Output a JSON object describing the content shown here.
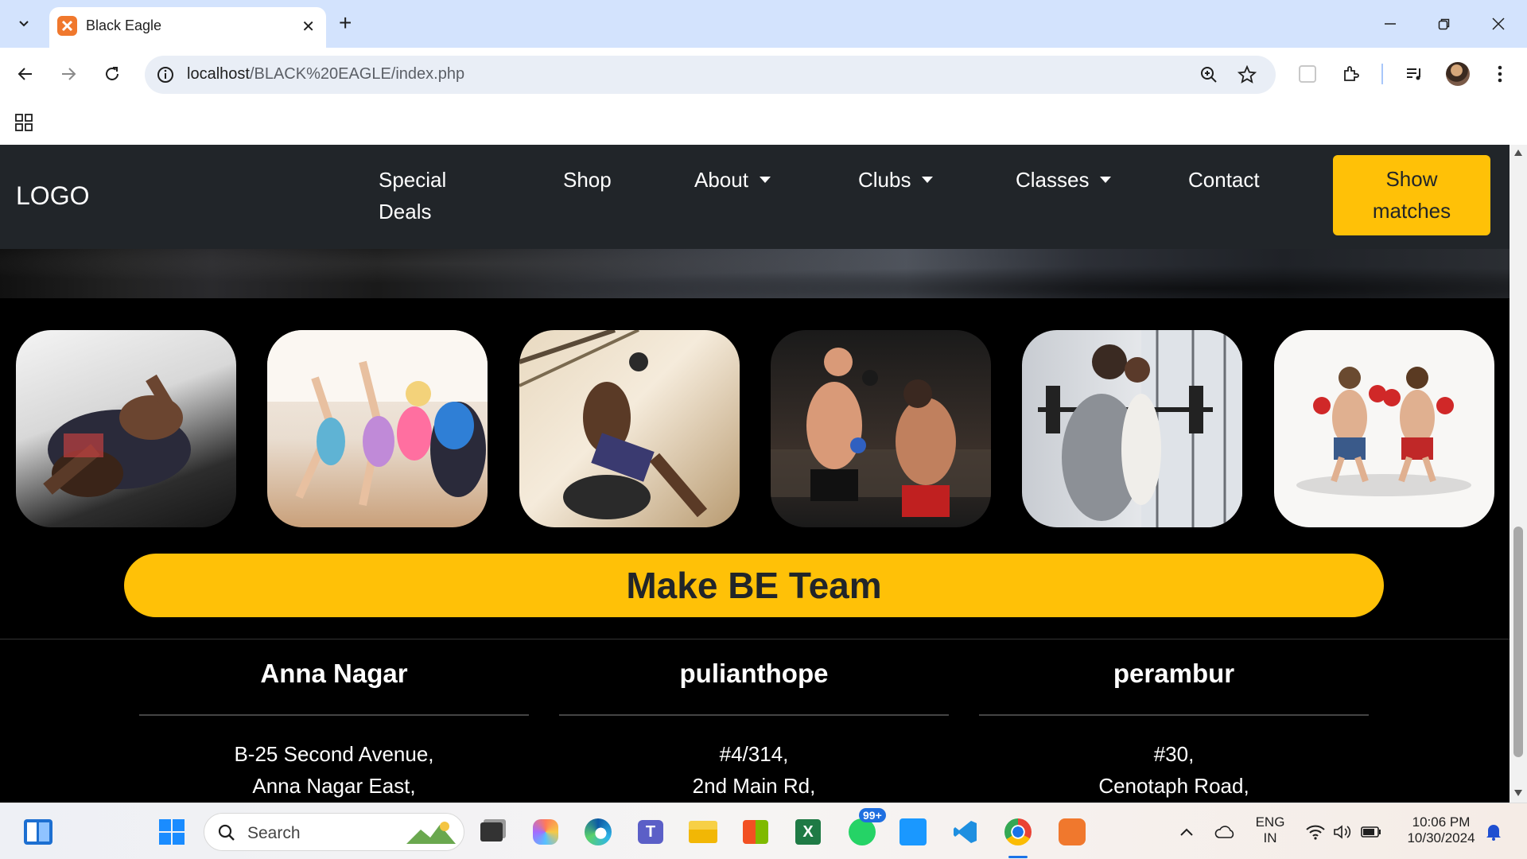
{
  "browser": {
    "tab_title": "Black Eagle",
    "url_host": "localhost",
    "url_path": "/BLACK%20EAGLE/index.php"
  },
  "site": {
    "logo": "LOGO",
    "nav": [
      {
        "label_line1": "Special",
        "label_line2": "Deals"
      },
      {
        "label": "Shop"
      },
      {
        "label": "About"
      },
      {
        "label": "Clubs"
      },
      {
        "label": "Classes"
      },
      {
        "label": "Contact"
      }
    ],
    "cta_line1": "Show",
    "cta_line2": "matches",
    "gallery_subjects": [
      "grappling-photo",
      "yoga-class-photo",
      "boxing-knockdown-photo",
      "mma-fight-photo",
      "personal-trainer-photo",
      "boxers-illustration"
    ],
    "team_button": "Make BE Team",
    "branches": [
      {
        "name": "Anna Nagar",
        "line1": "B-25 Second Avenue,",
        "line2": "Anna Nagar East,"
      },
      {
        "name": "pulianthope",
        "line1": "#4/314,",
        "line2": "2nd Main Rd,"
      },
      {
        "name": "perambur",
        "line1": "#30,",
        "line2": "Cenotaph Road,"
      }
    ],
    "accent_color": "#ffc107",
    "navbar_color": "#212529"
  },
  "taskbar": {
    "search_label": "Search",
    "whatsapp_badge": "99+",
    "lang_line1": "ENG",
    "lang_line2": "IN",
    "time": "10:06 PM",
    "date": "10/30/2024"
  }
}
